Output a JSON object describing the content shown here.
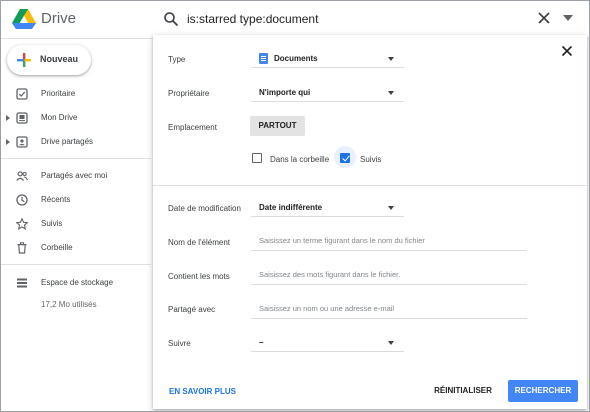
{
  "app": {
    "title": "Drive"
  },
  "search": {
    "query": "is:starred type:document"
  },
  "sidebar": {
    "new_label": "Nouveau",
    "items": [
      {
        "label": "Prioritaire",
        "icon": "checkbox-icon"
      },
      {
        "label": "Mon Drive",
        "icon": "my-drive-icon"
      },
      {
        "label": "Drive partagés",
        "icon": "shared-drives-icon"
      },
      {
        "label": "Partagés avec moi",
        "icon": "people-icon"
      },
      {
        "label": "Récents",
        "icon": "clock-icon"
      },
      {
        "label": "Suivis",
        "icon": "star-icon"
      },
      {
        "label": "Corbeille",
        "icon": "trash-icon"
      },
      {
        "label": "Espace de stockage",
        "icon": "storage-icon"
      }
    ],
    "storage_used": "17,2 Mo utilisés"
  },
  "panel": {
    "type_label": "Type",
    "type_value": "Documents",
    "owner_label": "Propriétaire",
    "owner_value": "N'importe qui",
    "location_label": "Emplacement",
    "location_button": "PARTOUT",
    "trash_checkbox": {
      "label": "Dans la corbeille",
      "checked": false
    },
    "starred_checkbox": {
      "label": "Suivis",
      "checked": true
    },
    "modified_label": "Date de modification",
    "modified_value": "Date indifférente",
    "item_name_label": "Nom de l'élément",
    "item_name_placeholder": "Saisissez un terme figurant dans le nom du fichier",
    "contains_label": "Contient les mots",
    "contains_placeholder": "Saisissez des mots figurant dans le fichier.",
    "shared_with_label": "Partagé avec",
    "shared_with_placeholder": "Saisissez un nom ou une adresse e-mail",
    "follow_label": "Suivre",
    "follow_value": "–",
    "learn_more": "EN SAVOIR PLUS",
    "reset": "RÉINITIALISER",
    "submit": "RECHERCHER"
  },
  "colors": {
    "accent": "#1a73e8",
    "primary_button": "#4285f4",
    "doc_icon": "#4285f4"
  }
}
